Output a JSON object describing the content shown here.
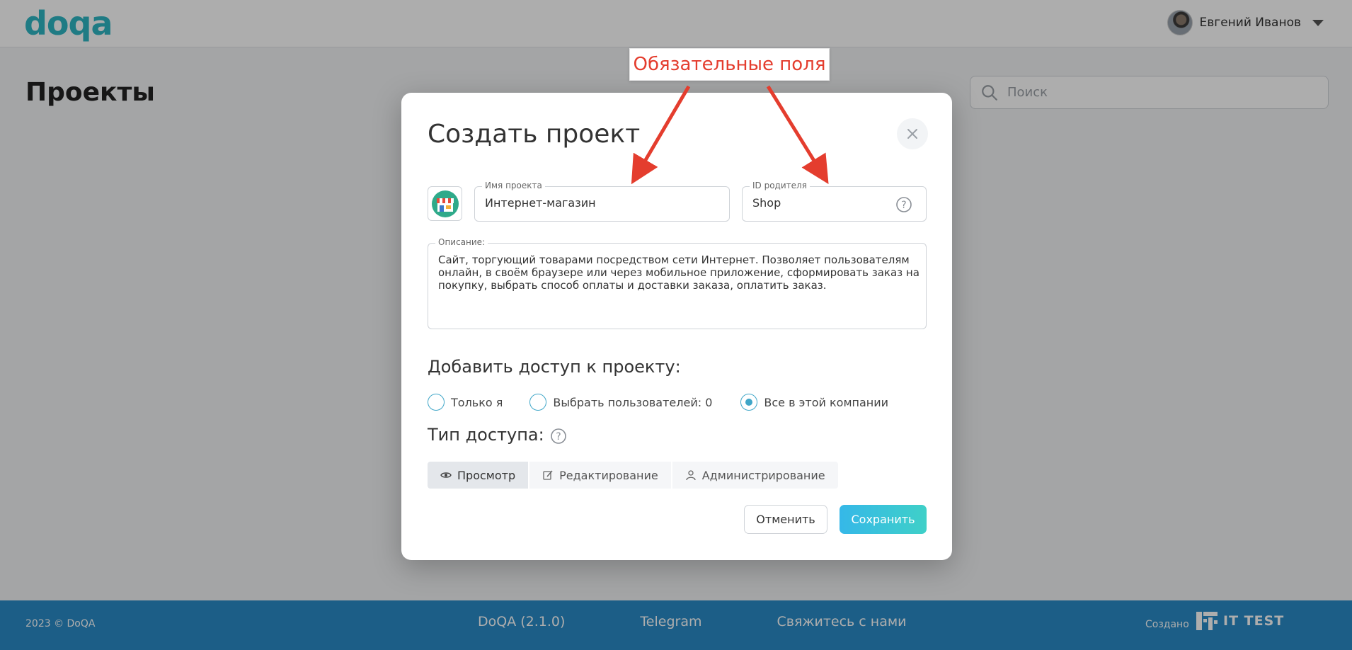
{
  "header": {
    "logo": "doqa",
    "user_name": "Евгений Иванов"
  },
  "page": {
    "title": "Проекты",
    "search_placeholder": "Поиск"
  },
  "modal": {
    "title": "Создать проект",
    "project_name_label": "Имя проекта",
    "project_name_value": "Интернет-магазин",
    "parent_id_label": "ID родителя",
    "parent_id_value": "Shop",
    "description_label": "Описание:",
    "description_value": "Сайт, торгующий товарами посредством сети Интернет. Позволяет пользователям онлайн, в своём браузере или через мобильное приложение, сформировать заказ на покупку, выбрать способ оплаты и доставки заказа, оплатить заказ.",
    "access_title": "Добавить доступ к проекту:",
    "access_options": [
      {
        "label": "Только я",
        "selected": false
      },
      {
        "label": "Выбрать пользователей: 0",
        "selected": false
      },
      {
        "label": "Все в этой компании",
        "selected": true
      }
    ],
    "access_type_title": "Тип доступа:",
    "access_types": [
      {
        "label": "Просмотр",
        "icon": "eye-icon",
        "active": true
      },
      {
        "label": "Редактирование",
        "icon": "edit-icon",
        "active": false
      },
      {
        "label": "Администрирование",
        "icon": "user-icon",
        "active": false
      }
    ],
    "cancel_label": "Отменить",
    "save_label": "Сохранить"
  },
  "annotation": {
    "text": "Обязательные поля"
  },
  "footer": {
    "copyright": "2023 © DoQA",
    "version": "DoQA (2.1.0)",
    "telegram": "Telegram",
    "contact": "Свяжитесь с нами",
    "created_by": "Создано",
    "brand": "IT TEST"
  },
  "colors": {
    "accent": "#3fa6c8",
    "footer": "#2a8bc7",
    "annotation": "#e43d2e"
  }
}
